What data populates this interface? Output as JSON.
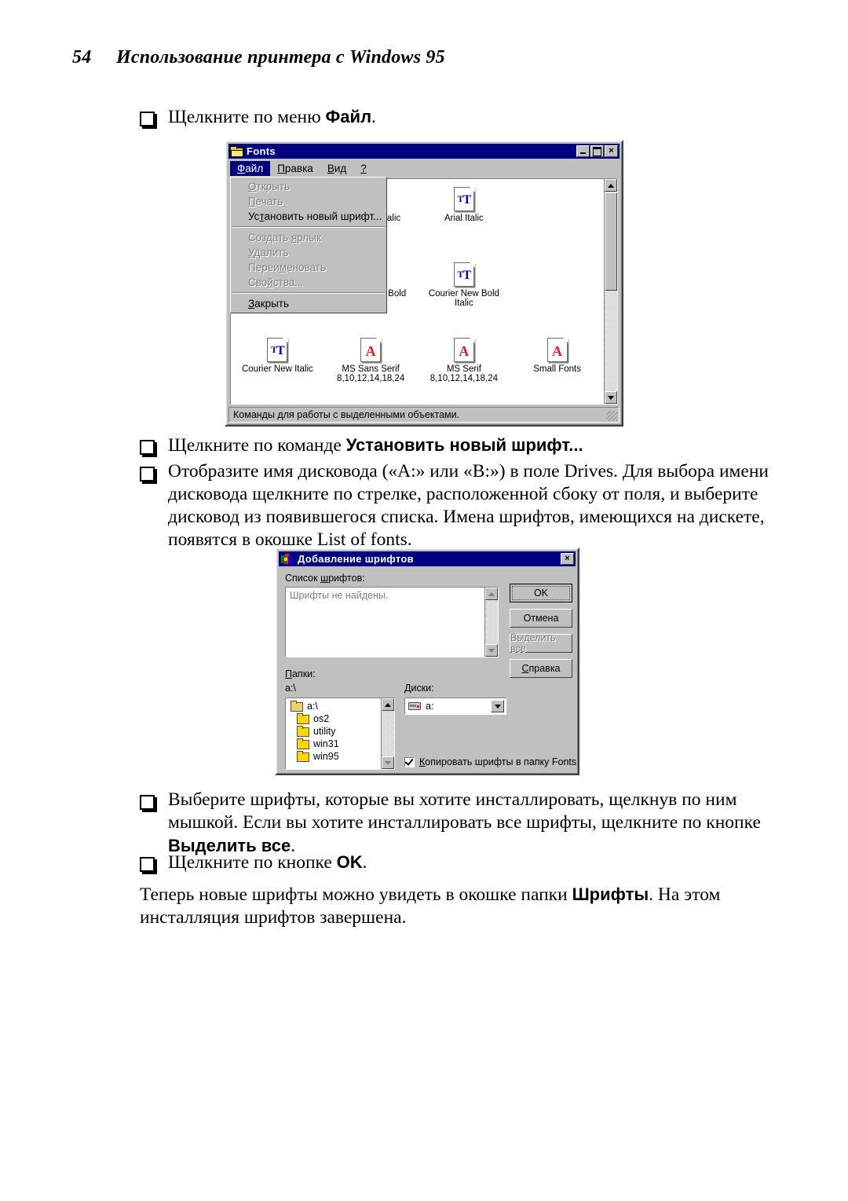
{
  "page": {
    "number": "54",
    "chapter_title": "Использование принтера с Windows 95"
  },
  "steps": {
    "step1": {
      "text_before": "Щелкните по меню ",
      "bold": "Файл",
      "text_after": "."
    },
    "step2": {
      "text_before": "Щелкните по команде ",
      "bold": "Установить новый шрифт...",
      "text_after": ""
    },
    "step3": {
      "text": "Отобразите имя дисковода («A:» или «B:») в поле Drives. Для выбора имени дисковода щелкните по стрелке, расположенной сбоку от поля, и выберите дисковод из появившегося списка. Имена шрифтов, имеющихся на дискете, появятся в окошке List of fonts."
    },
    "step4": {
      "text_before": "Выберите шрифты, которые вы хотите инсталлировать, щелкнув по ним мышкой. Если вы хотите инсталлировать все шрифты, щелкните по кнопке ",
      "bold": "Выделить все",
      "text_after": "."
    },
    "step5": {
      "text_before": "Щелкните по кнопке ",
      "bold": "OK",
      "text_after": "."
    },
    "closing": {
      "text_before": "Теперь новые шрифты можно увидеть в окошке папки ",
      "bold": "Шрифты",
      "text_after": ". На этом инсталляция шрифтов завершена."
    }
  },
  "fonts_window": {
    "title": "Fonts",
    "titlebar_icon": "folder-icon",
    "buttons": {
      "minimize": "minimize-icon",
      "maximize": "maximize-icon",
      "close": "×"
    },
    "menubar": [
      {
        "label": "Файл",
        "accel": "Ф",
        "active": true
      },
      {
        "label": "Правка",
        "accel": "П",
        "active": false
      },
      {
        "label": "Вид",
        "accel": "В",
        "active": false
      },
      {
        "label": "?",
        "accel": "?",
        "active": false
      }
    ],
    "file_menu": [
      {
        "label": "Открыть",
        "accel": "О",
        "disabled": true,
        "separator_after": false
      },
      {
        "label": "Печать",
        "accel": "П",
        "disabled": true,
        "separator_after": false
      },
      {
        "label": "Установить новый шрифт...",
        "accel": "т",
        "disabled": false,
        "separator_after": true
      },
      {
        "label": "Создать ярлык",
        "accel": "я",
        "disabled": true,
        "separator_after": false
      },
      {
        "label": "Удалить",
        "accel": "У",
        "disabled": true,
        "separator_after": false
      },
      {
        "label": "Переименовать",
        "accel": "м",
        "disabled": true,
        "separator_after": false
      },
      {
        "label": "Свойства...",
        "accel": "й",
        "disabled": true,
        "separator_after": true
      },
      {
        "label": "Закрыть",
        "accel": "З",
        "disabled": false,
        "separator_after": false
      }
    ],
    "icons": [
      {
        "name": "Arial Bold Italic",
        "sizes": "",
        "kind": "truetype"
      },
      {
        "name": "Arial Italic",
        "sizes": "",
        "kind": "truetype"
      },
      {
        "name": "Courier New Bold",
        "sizes": "",
        "kind": "truetype"
      },
      {
        "name": "Courier New Bold Italic",
        "sizes": "",
        "kind": "truetype"
      },
      {
        "name": "Courier New Italic",
        "sizes": "",
        "kind": "truetype"
      },
      {
        "name": "MS Sans Serif",
        "sizes": "8,10,12,14,18,24",
        "kind": "bitmap"
      },
      {
        "name": "MS Serif",
        "sizes": "8,10,12,14,18,24",
        "kind": "bitmap"
      },
      {
        "name": "Small Fonts",
        "sizes": "",
        "kind": "bitmap"
      }
    ],
    "partial_row_kinds": [
      "truetype",
      "bitmap",
      "truetype",
      "truetype"
    ],
    "statusbar": "Команды для работы с выделенными объектами."
  },
  "add_fonts_dialog": {
    "title": "Добавление шрифтов",
    "titlebar_icon": "fonts-icon",
    "close_button": "×",
    "fonts_list_label": "Список шрифтов:",
    "fonts_list_items": [
      "Шрифты не найдены."
    ],
    "buttons": [
      {
        "label": "OK",
        "default": true,
        "disabled": false
      },
      {
        "label": "Отмена",
        "default": false,
        "disabled": false
      },
      {
        "label": "Выделить все",
        "default": false,
        "disabled": true
      },
      {
        "label": "Справка",
        "default": false,
        "disabled": false
      }
    ],
    "folders_label": "Папки:",
    "current_path": "a:\\",
    "folder_tree": [
      {
        "label": "a:\\",
        "open": true
      },
      {
        "label": "os2",
        "open": false
      },
      {
        "label": "utility",
        "open": false
      },
      {
        "label": "win31",
        "open": false
      },
      {
        "label": "win95",
        "open": false
      }
    ],
    "drives_label": "Диски:",
    "drive_selected": "a:",
    "copy_checkbox": {
      "label": "Копировать шрифты в папку Fonts",
      "checked": true
    }
  },
  "colors": {
    "titlebar": "#000080",
    "face": "#c0c0c0",
    "truetype_blue": "#0000cc",
    "bitmap_red": "#e02020",
    "folder_yellow": "#ffd700"
  }
}
